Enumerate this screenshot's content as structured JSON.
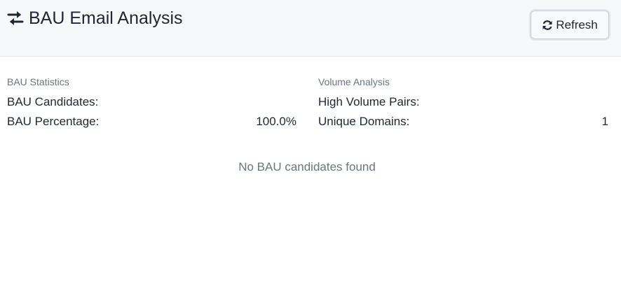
{
  "header": {
    "title": "BAU Email Analysis",
    "title_icon": "exchange-arrows-icon",
    "refresh_label": "Refresh",
    "refresh_icon": "sync-icon"
  },
  "bau_statistics": {
    "title": "BAU Statistics",
    "rows": [
      {
        "label": "BAU Candidates:",
        "value": ""
      },
      {
        "label": "BAU Percentage:",
        "value": "100.0%"
      }
    ]
  },
  "volume_analysis": {
    "title": "Volume Analysis",
    "rows": [
      {
        "label": "High Volume Pairs:",
        "value": ""
      },
      {
        "label": "Unique Domains:",
        "value": "1"
      }
    ]
  },
  "empty_state": {
    "message": "No BAU candidates found"
  },
  "colors": {
    "header_bg": "#f7f8fa",
    "text": "#1f2733",
    "muted": "#6c757d"
  }
}
